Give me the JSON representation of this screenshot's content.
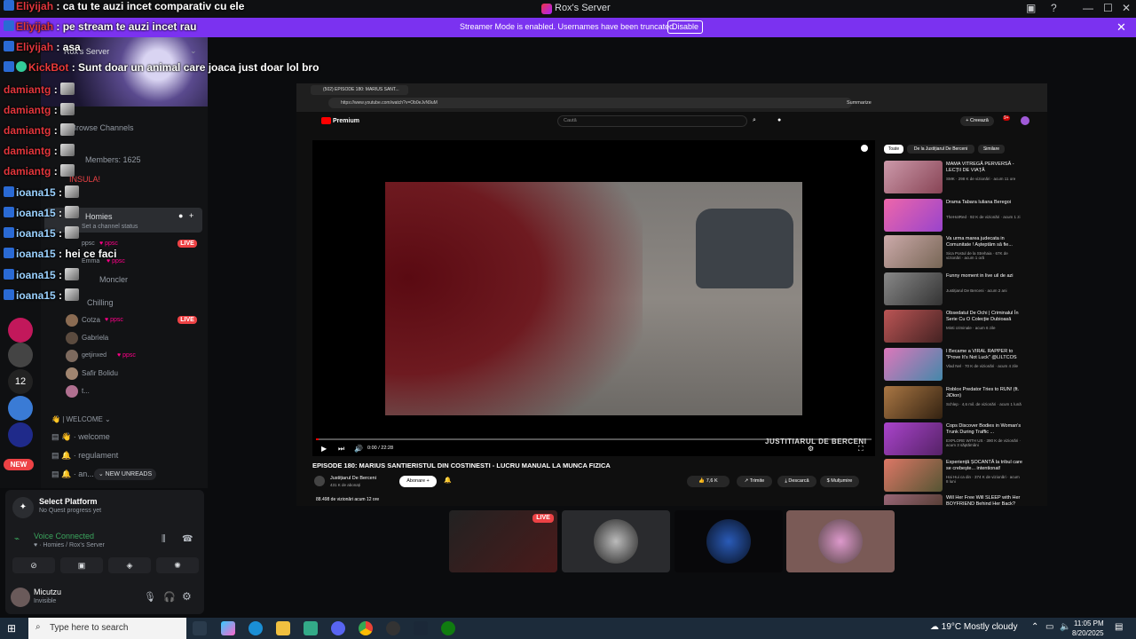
{
  "window": {
    "title": "Rox's Server"
  },
  "banner": {
    "text": "Streamer Mode is enabled. Usernames have been truncated.",
    "button": "Disable"
  },
  "server": {
    "name": "Rox's Server"
  },
  "sidebar": {
    "browse_channels": "Browse Channels",
    "members": "Members: 1625",
    "section_insula": "INSULA!",
    "voice_channel": "Homies",
    "status": "Set a channel status",
    "voice_users": [
      {
        "name": "ppsc",
        "tag": "ppsc",
        "live": "LIVE"
      },
      {
        "name": "Emma",
        "tag": "ppsc"
      },
      {
        "name": "Moncler"
      },
      {
        "name": "Chilling"
      },
      {
        "name": "Cotza",
        "tag": "ppsc",
        "live": "LIVE"
      },
      {
        "name": "Gabriela"
      },
      {
        "name": "getjinxed",
        "tag": "ppsc"
      },
      {
        "name": "Safir Bolidu"
      },
      {
        "name": "t..."
      }
    ],
    "welcome_category": "| WELCOME",
    "channels": [
      "welcome",
      "regulament",
      "an..."
    ],
    "new_unreads": "NEW UNREADS",
    "new_badge": "NEW",
    "rail_number": "12"
  },
  "chat": [
    {
      "user": "Eliyijah",
      "text": ": ca tu te auzi incet comparativ cu ele"
    },
    {
      "user": "Eliyijah",
      "text": ": pe stream te auzi incet rau"
    },
    {
      "user": "Eliyijah",
      "text": ": asa"
    },
    {
      "user": "KickBot",
      "text": ": Sunt doar un animal care joaca just doar lol bro"
    },
    {
      "user": "damiantg",
      "text": ":"
    },
    {
      "user": "damiantg",
      "text": ":"
    },
    {
      "user": "damiantg",
      "text": ":"
    },
    {
      "user": "damiantg",
      "text": ":"
    },
    {
      "user": "damiantg",
      "text": ":"
    },
    {
      "user": "ioana15",
      "text": ":"
    },
    {
      "user": "ioana15",
      "text": ":"
    },
    {
      "user": "ioana15",
      "text": ":"
    },
    {
      "user": "ioana15",
      "text": ": hei ce faci"
    },
    {
      "user": "ioana15",
      "text": ":"
    },
    {
      "user": "ioana15",
      "text": ":"
    }
  ],
  "panel": {
    "quest_title": "Select Platform",
    "quest_sub": "No Quest progress yet",
    "voice_connected": "Voice Connected",
    "voice_location": "Homies / Rox's Server",
    "user": "Micutzu",
    "user_status": "Invisible"
  },
  "browser": {
    "tab": "(502) EPISODE 180: MARIUS SANT...",
    "url": "https://www.youtube.com/watch?v=Ob0eJvN9uM",
    "summarize": "Summarize",
    "yt_logo": "Premium",
    "search_placeholder": "Caută",
    "create": "Creează",
    "notif": "9+",
    "chips": [
      "Toate",
      "De la Justițiarul De Berceni",
      "Similare"
    ],
    "time": "0:00 / 22:28",
    "watermark": "JUSTITIARUL DE BERCENI",
    "video_title": "EPISODE 180: MARIUS SANTIERISTUL DIN COSTINESTI - LUCRU MANUAL LA MUNCA FIZICA",
    "channel": "Justițiarul De Berceni",
    "subs": "431 K de abonați",
    "subscribe": "Abonare",
    "likes": "7,6 K",
    "share": "Trimite",
    "download": "Descarcă",
    "thanks": "Mulțumire",
    "views": "88.498 de vizionări  acum 12 ore"
  },
  "sidebar_videos": [
    {
      "title": "MAMA VITREGĂ PERVERSĂ - LECȚII DE VIAȚĂ",
      "meta": "SMK · 298 K de vizionări · acum 11 ore",
      "dur": "58:55"
    },
    {
      "title": "Drama Tabara Iuliana Beregoi",
      "meta": "TheHotRed · 92 K de vizionări · acum 1 zi",
      "dur": "24:38"
    },
    {
      "title": "Va urma marea judecata in Comunitate ! Așteptăm să fie...",
      "meta": "Sica Postul de la Strehaia · 67K de vizionări · acum 1 oră",
      "dur": "20:11"
    },
    {
      "title": "Funny moment in live uil de azi",
      "meta": "Justițiarul De Berceni · acum 2 ani",
      "dur": "1:36"
    },
    {
      "title": "Obsedatul De Ochi | Criminalul În Serie Cu O Colecție Dubioasă",
      "meta": "Minti criminale · acum 6 zile",
      "dur": "32:47"
    },
    {
      "title": "I Became a VIRAL RAPPER to \"Prove It's Not Luck\" @LILTCOS",
      "meta": "Vlad Nel · 70 K de vizionări · acum 4 zile",
      "dur": "47:57"
    },
    {
      "title": "Roblox Predator Tries to RUN! (ft. JiDion)",
      "meta": "Schlep · 4,6 mil. de vizionări · acum 1 lună",
      "dur": "37:25"
    },
    {
      "title": "Cops Discover Bodies in Woman's Trunk During Traffic ...",
      "meta": "EXPLORE WITH US · 390 K de vizionări · acum 3 săptămâni",
      "dur": "49:43"
    },
    {
      "title": "Experiență ȘOCANTĂ la tribul care se crebește... intentionat!",
      "meta": "Hai Hui ca din · 374 K de vizionări · acum 8 luni",
      "dur": "44:31"
    },
    {
      "title": "Will Her Free Will SLEEP with Her BOYFRIEND Behind Her Back?",
      "meta": "",
      "dur": ""
    }
  ],
  "tiles": [
    {
      "live": "LIVE"
    }
  ],
  "taskbar": {
    "search": "Type here to search",
    "weather": "19°C  Mostly cloudy",
    "time": "11:05 PM",
    "date": "8/20/2025"
  }
}
